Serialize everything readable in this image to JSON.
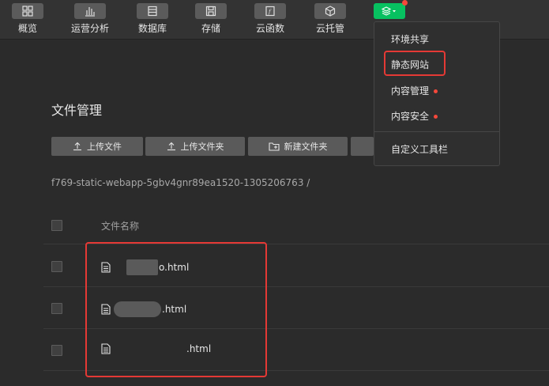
{
  "toolbar": {
    "items": [
      {
        "label": "概览",
        "icon": "grid-icon"
      },
      {
        "label": "运营分析",
        "icon": "bar-chart-icon"
      },
      {
        "label": "数据库",
        "icon": "database-icon"
      },
      {
        "label": "存储",
        "icon": "save-icon"
      },
      {
        "label": "云函数",
        "icon": "function-icon"
      },
      {
        "label": "云托管",
        "icon": "box-icon"
      }
    ],
    "active_icon": "layers-icon"
  },
  "dropdown": {
    "items": [
      {
        "label": "环境共享",
        "dot": false
      },
      {
        "label": "静态网站",
        "dot": false
      },
      {
        "label": "内容管理",
        "dot": true
      },
      {
        "label": "内容安全",
        "dot": true
      },
      {
        "label": "自定义工具栏",
        "dot": false
      }
    ]
  },
  "main": {
    "title": "文件管理",
    "buttons": {
      "upload_file": "上传文件",
      "upload_folder": "上传文件夹",
      "new_folder": "新建文件夹"
    },
    "path": "f769-static-webapp-5gbv4gnr89ea1520-1305206763 /",
    "table": {
      "column_header": "文件名称",
      "rows": [
        {
          "name": "o.html"
        },
        {
          "name": ".html"
        },
        {
          "name": ".html"
        }
      ]
    }
  },
  "colors": {
    "accent": "#07c160",
    "highlight": "#e53935",
    "dot": "#f5483b"
  }
}
